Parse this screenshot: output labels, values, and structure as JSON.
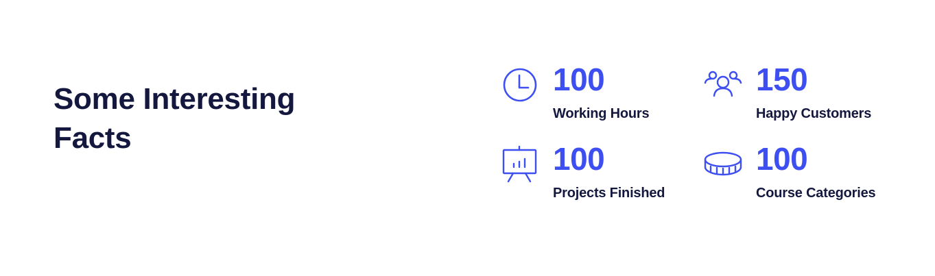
{
  "facts": {
    "title": "Some Interesting Facts",
    "accent_color": "#3d4ff0",
    "text_color": "#14183e",
    "stats": [
      {
        "icon": "clock-icon",
        "number": "100",
        "label": "Working Hours"
      },
      {
        "icon": "customers-icon",
        "number": "150",
        "label": "Happy Customers"
      },
      {
        "icon": "presentation-board-icon",
        "number": "100",
        "label": "Projects Finished"
      },
      {
        "icon": "coin-icon",
        "number": "100",
        "label": "Course Categories"
      }
    ]
  }
}
